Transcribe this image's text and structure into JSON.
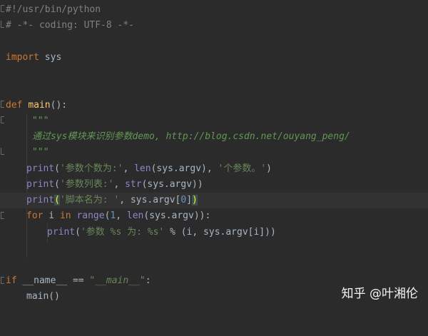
{
  "editor": {
    "shebang": "#!/usr/bin/python",
    "coding": "# -*- coding: UTF-8 -*-",
    "import_kw": "import",
    "import_mod": " sys",
    "def_kw": "def",
    "func_name": "main",
    "func_sig": "():",
    "doc_open": "\"\"\"",
    "doc_text": "通过sys模块来识别参数demo, http://blog.csdn.net/ouyang_peng/",
    "doc_close": "\"\"\"",
    "print_kw": "print",
    "l1_str1": "'参数个数为:'",
    "l1_mid": ", ",
    "l1_len": "len",
    "l1_arg": "(sys.argv), ",
    "l1_str2": "'个参数。'",
    "l1_end": ")",
    "l2_str1": "'参数列表:'",
    "l2_mid": ", ",
    "l2_str": "str",
    "l2_arg": "(sys.argv))",
    "l3_open": "(",
    "l3_str1": "'脚本名为: '",
    "l3_mid": ", sys.argv[",
    "l3_num": "0",
    "l3_close_br": "]",
    "l3_close": ")",
    "for_kw": "for",
    "for_var": " i ",
    "in_kw": "in",
    "range_fn": "range",
    "for_open": "(",
    "for_num": "1",
    "for_mid": ", ",
    "for_len": "len",
    "for_end": "(sys.argv)):",
    "l4_open": "(",
    "l4_str": "'参数 %s 为: %s'",
    "l4_end": " % (i, sys.argv[i]))",
    "if_kw": "if",
    "if_name": " __name__ ",
    "if_eq": "== ",
    "if_str": "\"__main__\"",
    "if_colon": ":",
    "call_main": "main()"
  },
  "watermark": "知乎 @叶湘伦"
}
